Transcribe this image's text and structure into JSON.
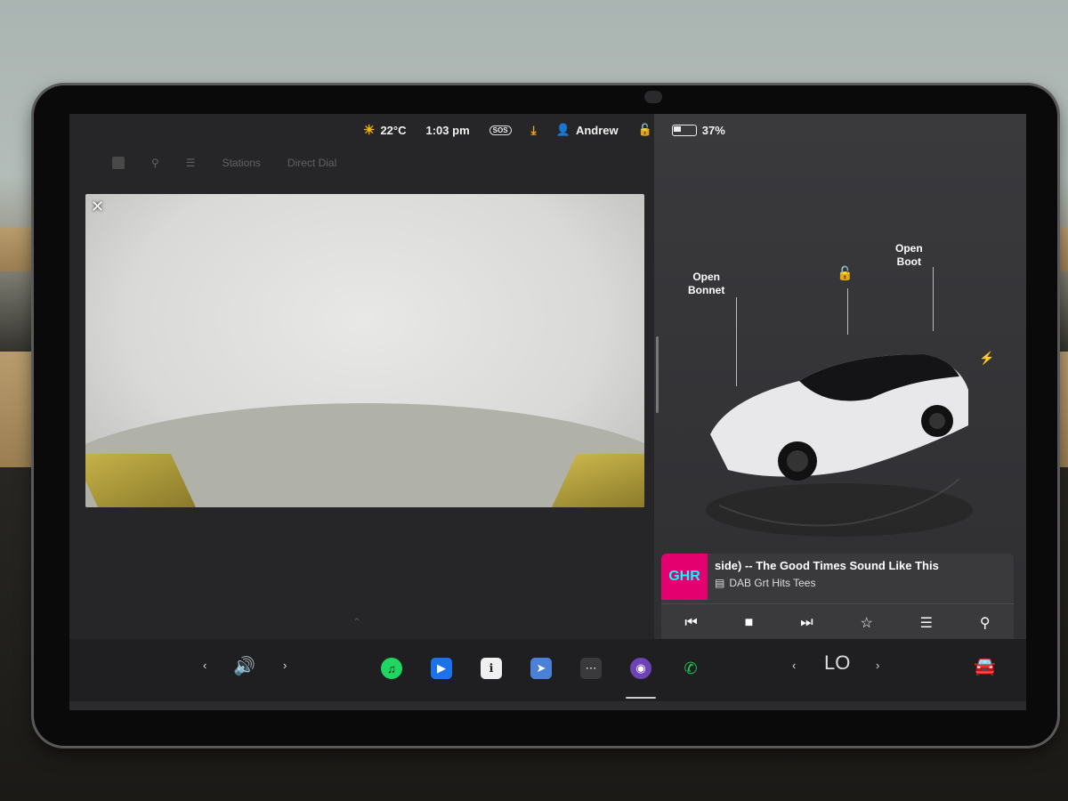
{
  "status": {
    "temperature": "22°C",
    "time": "1:03 pm",
    "sos": "SOS",
    "user": "Andrew",
    "battery_percent": "37%",
    "battery_level": 0.37
  },
  "nav_faded": {
    "tab1": "Stations",
    "tab2": "Direct Dial"
  },
  "car": {
    "open_bonnet": [
      "Open",
      "Bonnet"
    ],
    "open_boot": [
      "Open",
      "Boot"
    ]
  },
  "media": {
    "art_text": "GHR",
    "song_title": "side) -- The Good Times Sound Like This",
    "station": "DAB Grt Hits Tees"
  },
  "climate": {
    "temp_label": "LO"
  },
  "colors": {
    "spotify": "#1ed760",
    "zoom": "#1a73e8",
    "phone": "#22cc55",
    "art_bg": "#e4006e"
  }
}
